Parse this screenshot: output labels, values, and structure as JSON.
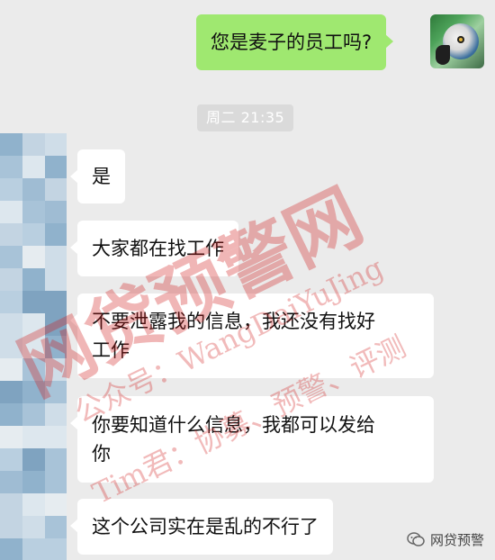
{
  "messages": [
    {
      "side": "self",
      "text": "您是麦子的员工吗?"
    },
    {
      "side": "other",
      "text": "是"
    },
    {
      "side": "other",
      "text": "大家都在找工作"
    },
    {
      "side": "other",
      "text_line1": "不要泄露我的信息，我还没有找好",
      "text_line2": "工作"
    },
    {
      "side": "other",
      "text_line1": "你要知道什么信息，我都可以发给",
      "text_line2": "你"
    },
    {
      "side": "other",
      "text": "这个公司实在是乱的不行了"
    }
  ],
  "timestamp": "周二 21:35",
  "watermark": {
    "main": "网贷预警网",
    "line1": "公众号：WangDaiYuJing",
    "line2": "Tim君：协募、预警、评测"
  },
  "source_tag": {
    "label": "网贷预警",
    "icon": "wechat-icon"
  },
  "colors": {
    "background": "#ebebeb",
    "self_bubble": "#9fe870",
    "other_bubble": "#ffffff",
    "watermark": "#d11b1b"
  }
}
